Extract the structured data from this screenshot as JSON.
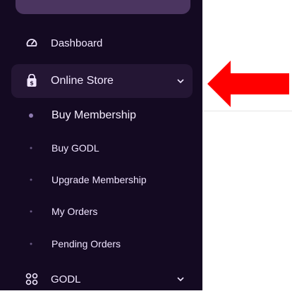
{
  "sidebar": {
    "main_items": [
      {
        "label": "Dashboard",
        "icon": "gauge-icon"
      },
      {
        "label": "Online Store",
        "icon": "shopping-bag-icon",
        "chevron": "chevron-down-icon"
      },
      {
        "label": "GODL",
        "icon": "apps-grid-icon",
        "chevron": "chevron-down-icon"
      }
    ],
    "submenu": [
      {
        "label": "Buy Membership",
        "active": true
      },
      {
        "label": "Buy GODL"
      },
      {
        "label": "Upgrade Membership"
      },
      {
        "label": "My Orders"
      },
      {
        "label": "Pending Orders"
      }
    ]
  },
  "colors": {
    "sidebar_bg": "#140a22",
    "active_item_bg": "#241634",
    "text": "#f1e7ff",
    "annotation_arrow": "#ff0000"
  }
}
